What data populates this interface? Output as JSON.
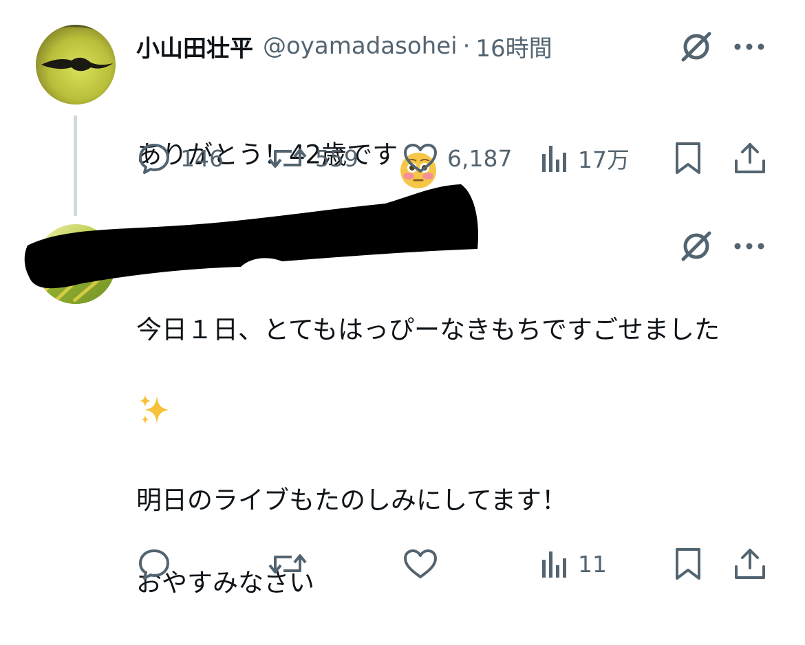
{
  "tweets": [
    {
      "author": {
        "display_name": "小山田壮平",
        "handle": "@oyamadasohei",
        "separator": "·",
        "time": "16時間"
      },
      "text": "ありがとう！42歳です",
      "emoji": "flushed-face-emoji",
      "metrics": {
        "replies": "146",
        "reposts": "559",
        "likes": "6,187",
        "views": "17万"
      }
    },
    {
      "author": {
        "display_name": "",
        "handle": "",
        "redacted": true
      },
      "text": "今日１日、とてもはっぴーなきもちですごせました",
      "text_emoji": "sparkles-emoji",
      "text_rest": "明日のライブもたのしみにしてます！\n\nおやすみなさい",
      "metrics": {
        "replies": "",
        "reposts": "",
        "likes": "",
        "views": "11"
      }
    }
  ],
  "icons": {
    "grok": "grok-icon",
    "more": "more-options-icon",
    "reply": "reply-icon",
    "repost": "repost-icon",
    "like": "like-icon",
    "views": "views-icon",
    "bookmark": "bookmark-icon",
    "share": "share-icon"
  },
  "colors": {
    "text_primary": "#0f1419",
    "text_secondary": "#536471",
    "thread_line": "#cfd9de"
  }
}
